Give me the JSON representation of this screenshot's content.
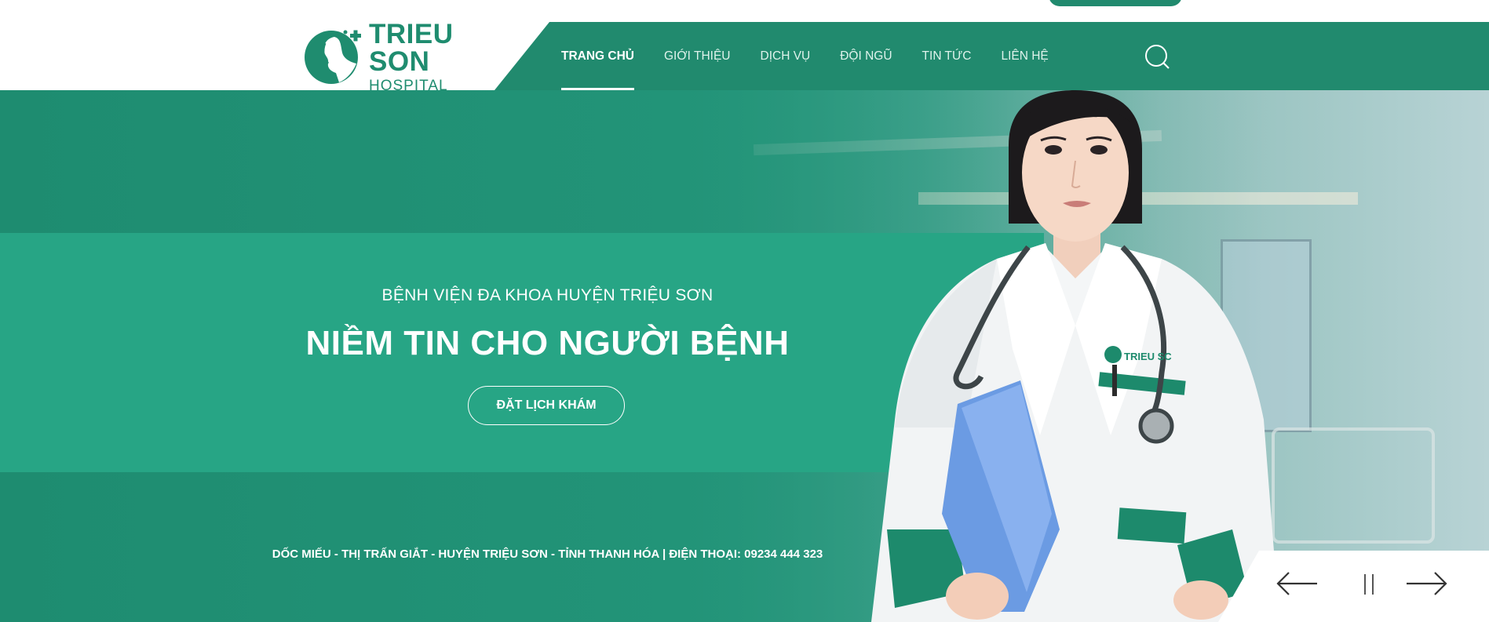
{
  "header": {
    "logo": {
      "title": "TRIEU SON",
      "subtitle": "HOSPITAL"
    },
    "nav": [
      {
        "label": "TRANG CHỦ",
        "active": true
      },
      {
        "label": "GIỚI THIỆU",
        "active": false
      },
      {
        "label": "DỊCH VỤ",
        "active": false
      },
      {
        "label": "ĐỘI NGŨ",
        "active": false
      },
      {
        "label": "TIN TỨC",
        "active": false
      },
      {
        "label": "LIÊN HỆ",
        "active": false
      }
    ],
    "search_icon": "search-icon"
  },
  "hero": {
    "subtitle": "BỆNH VIỆN ĐA KHOA HUYỆN TRIỆU SƠN",
    "headline": "NIỀM TIN CHO NGƯỜI BỆNH",
    "cta_label": "ĐẶT LỊCH KHÁM",
    "address": "DỐC MIẾU - THỊ TRẤN GIẮT - HUYỆN TRIỆU SƠN - TỈNH THANH HÓA | ĐIỆN THOẠI: 09234 444 323",
    "badge_text": "TRIEU SC HOSPITAL"
  },
  "slider": {
    "prev_icon": "arrow-left-icon",
    "pause_icon": "pause-icon",
    "next_icon": "arrow-right-icon"
  },
  "colors": {
    "brand": "#218a6e",
    "band": "#27a585",
    "text_light": "#ffffff"
  }
}
